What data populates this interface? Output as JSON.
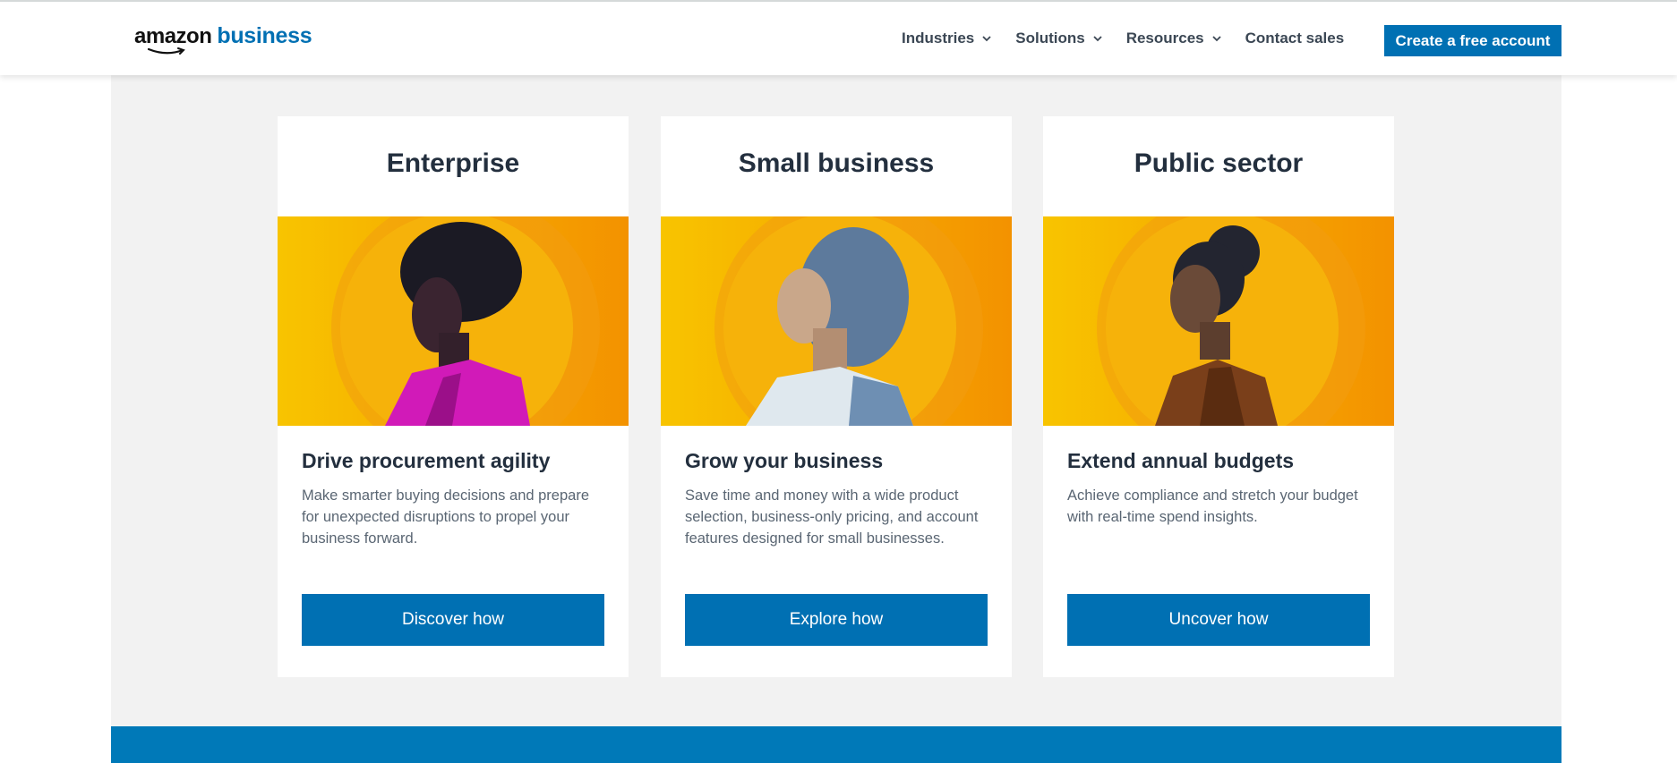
{
  "header": {
    "logo_text_amazon": "amazon",
    "logo_text_business": "business",
    "nav": [
      {
        "label": "Industries",
        "has_dropdown": true
      },
      {
        "label": "Solutions",
        "has_dropdown": true
      },
      {
        "label": "Resources",
        "has_dropdown": true
      },
      {
        "label": "Contact sales",
        "has_dropdown": false
      }
    ],
    "cta_label": "Create a free account"
  },
  "cards": [
    {
      "title": "Enterprise",
      "heading": "Drive procurement agility",
      "description": "Make smarter buying decisions and prepare for unexpected disruptions to propel your business forward.",
      "button_label": "Discover how"
    },
    {
      "title": "Small business",
      "heading": "Grow your business",
      "description": "Save time and money with a wide product selection, business-only pricing, and account features designed for small businesses.",
      "button_label": "Explore how"
    },
    {
      "title": "Public sector",
      "heading": "Extend annual budgets",
      "description": "Achieve compliance and stretch your budget with real-time spend insights.",
      "button_label": "Uncover how"
    }
  ],
  "colors": {
    "brand_blue": "#0070b3",
    "text_dark": "#232f3e",
    "text_muted": "#5a6673",
    "band_gray": "#f2f2f2",
    "image_yellow": "#f7b500",
    "image_orange": "#f39200"
  }
}
